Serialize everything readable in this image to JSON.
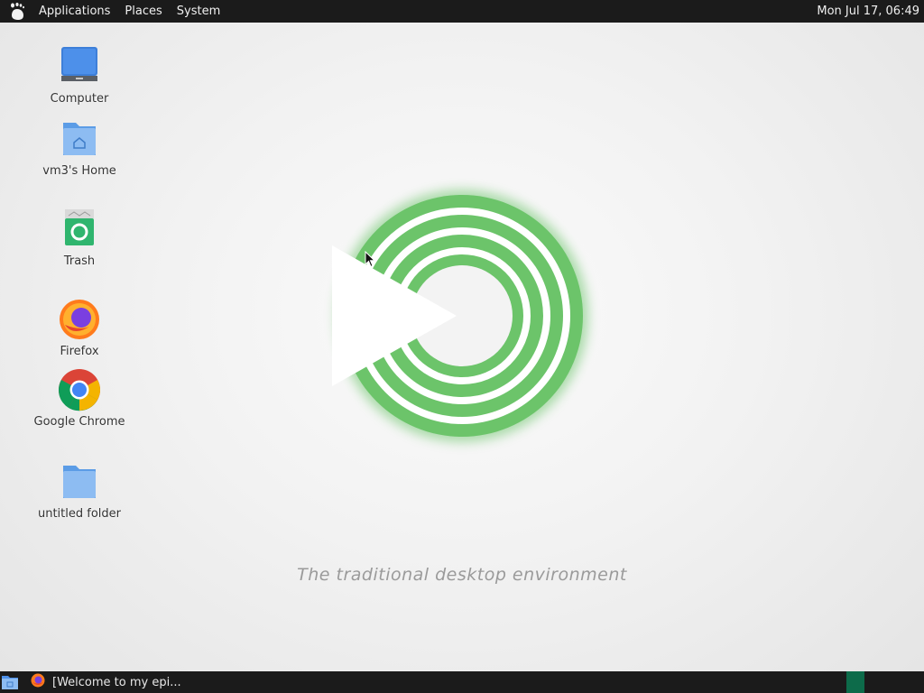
{
  "top_panel": {
    "menus": [
      "Applications",
      "Places",
      "System"
    ],
    "clock": "Mon Jul 17, 06:49"
  },
  "desktop_icons": [
    {
      "label": "Computer",
      "icon": "computer-icon"
    },
    {
      "label": "vm3's Home",
      "icon": "home-folder-icon"
    },
    {
      "label": "Trash",
      "icon": "trash-icon"
    },
    {
      "label": "Firefox",
      "icon": "firefox-icon"
    },
    {
      "label": "Google Chrome",
      "icon": "chrome-icon"
    },
    {
      "label": "untitled folder",
      "icon": "folder-icon"
    }
  ],
  "wallpaper": {
    "tagline": "The traditional desktop environment",
    "accent": "#6cc46a"
  },
  "bottom_panel": {
    "task_label": "[Welcome to my epi...",
    "workspace_color": "#0d6b4a"
  }
}
